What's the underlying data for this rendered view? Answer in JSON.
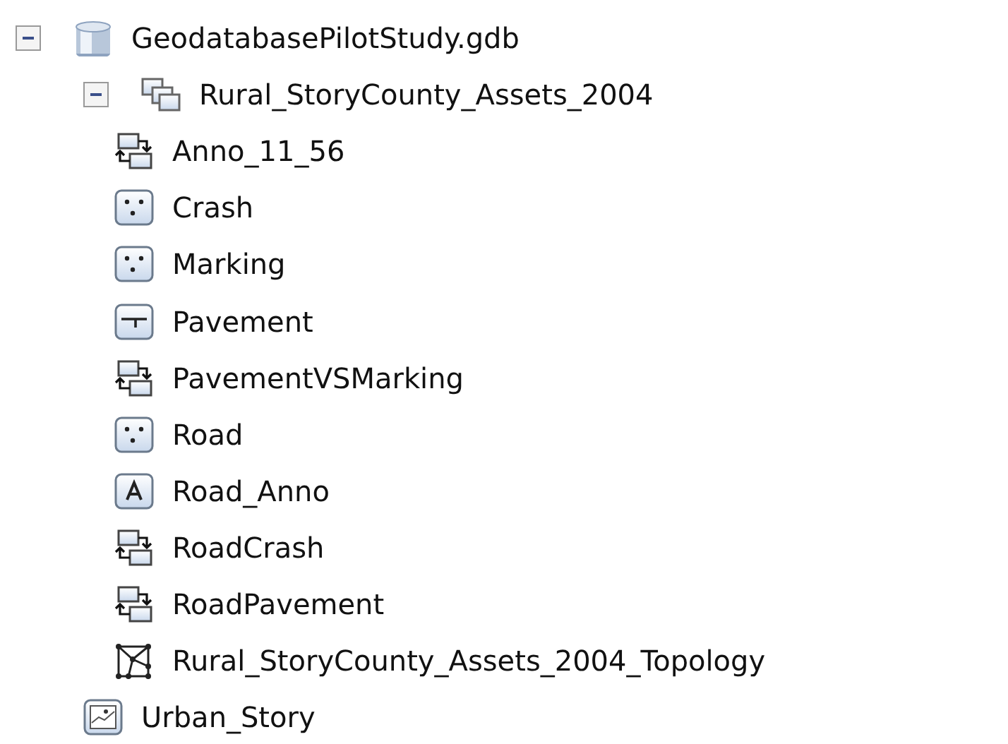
{
  "tree": [
    {
      "label": "GeodatabasePilotStudy.gdb",
      "kind": "geodatabase",
      "expanded": true,
      "children": [
        {
          "label": "Rural_StoryCounty_Assets_2004",
          "kind": "dataset",
          "expanded": true,
          "children": [
            {
              "label": "Anno_11_56",
              "kind": "relationship"
            },
            {
              "label": "Crash",
              "kind": "point"
            },
            {
              "label": "Marking",
              "kind": "point"
            },
            {
              "label": "Pavement",
              "kind": "line"
            },
            {
              "label": "PavementVSMarking",
              "kind": "relationship"
            },
            {
              "label": "Road",
              "kind": "point"
            },
            {
              "label": "Road_Anno",
              "kind": "annotation"
            },
            {
              "label": "RoadCrash",
              "kind": "relationship"
            },
            {
              "label": "RoadPavement",
              "kind": "relationship"
            },
            {
              "label": "Rural_StoryCounty_Assets_2004_Topology",
              "kind": "topology"
            }
          ]
        },
        {
          "label": "Urban_Story",
          "kind": "raster"
        }
      ]
    }
  ]
}
